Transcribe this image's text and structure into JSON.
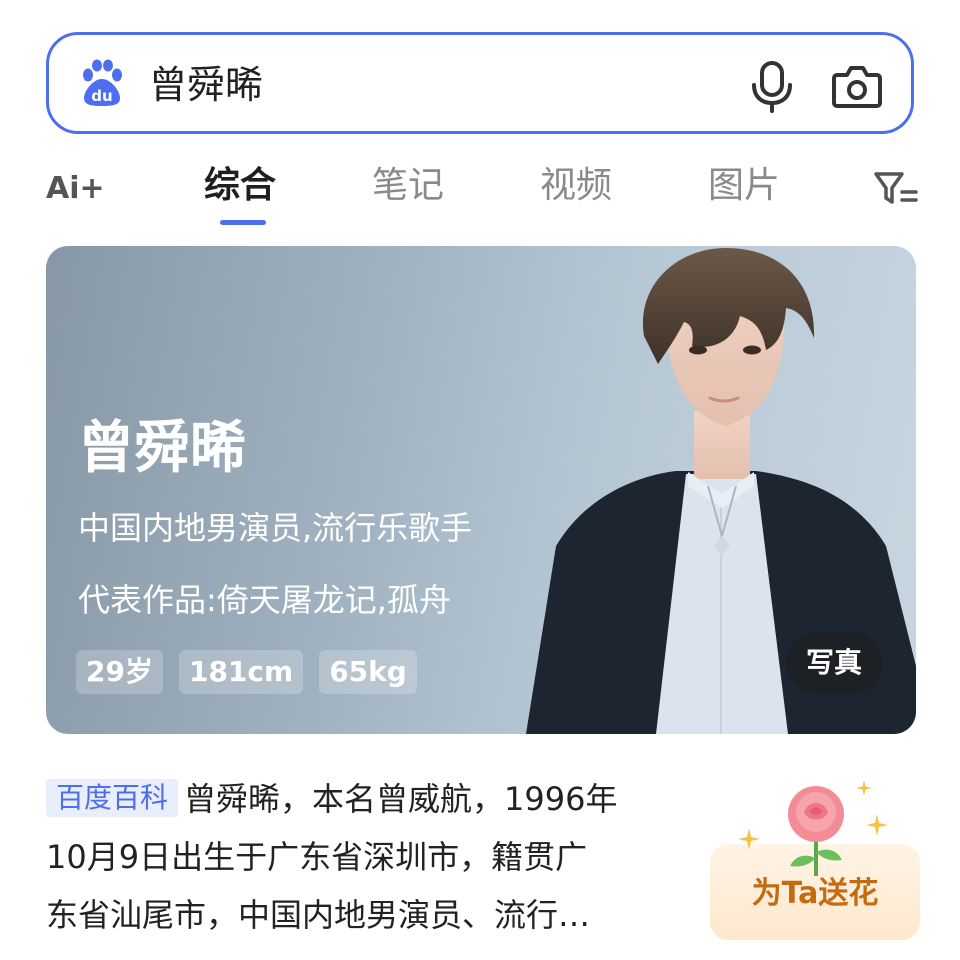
{
  "search": {
    "query": "曾舜晞"
  },
  "tabs": [
    {
      "label": "综合",
      "active": true
    },
    {
      "label": "笔记",
      "active": false
    },
    {
      "label": "视频",
      "active": false
    },
    {
      "label": "图片",
      "active": false
    }
  ],
  "ai_button_label": "Ai+",
  "hero": {
    "name": "曾舜晞",
    "description": "中国内地男演员,流行乐歌手",
    "works": "代表作品:倚天屠龙记,孤舟",
    "tags": [
      "29岁",
      "181cm",
      "65kg"
    ],
    "photo_button": "写真"
  },
  "baike": {
    "badge": "百度百科",
    "lines": [
      "曾舜晞，本名曾威航，1996年",
      "10月9日出生于广东省深圳市，籍贯广",
      "东省汕尾市，中国内地男演员、流行…"
    ]
  },
  "flower": {
    "label": "为Ta送花"
  },
  "colors": {
    "accent": "#4e6ef2",
    "flower_text": "#c46a10"
  }
}
